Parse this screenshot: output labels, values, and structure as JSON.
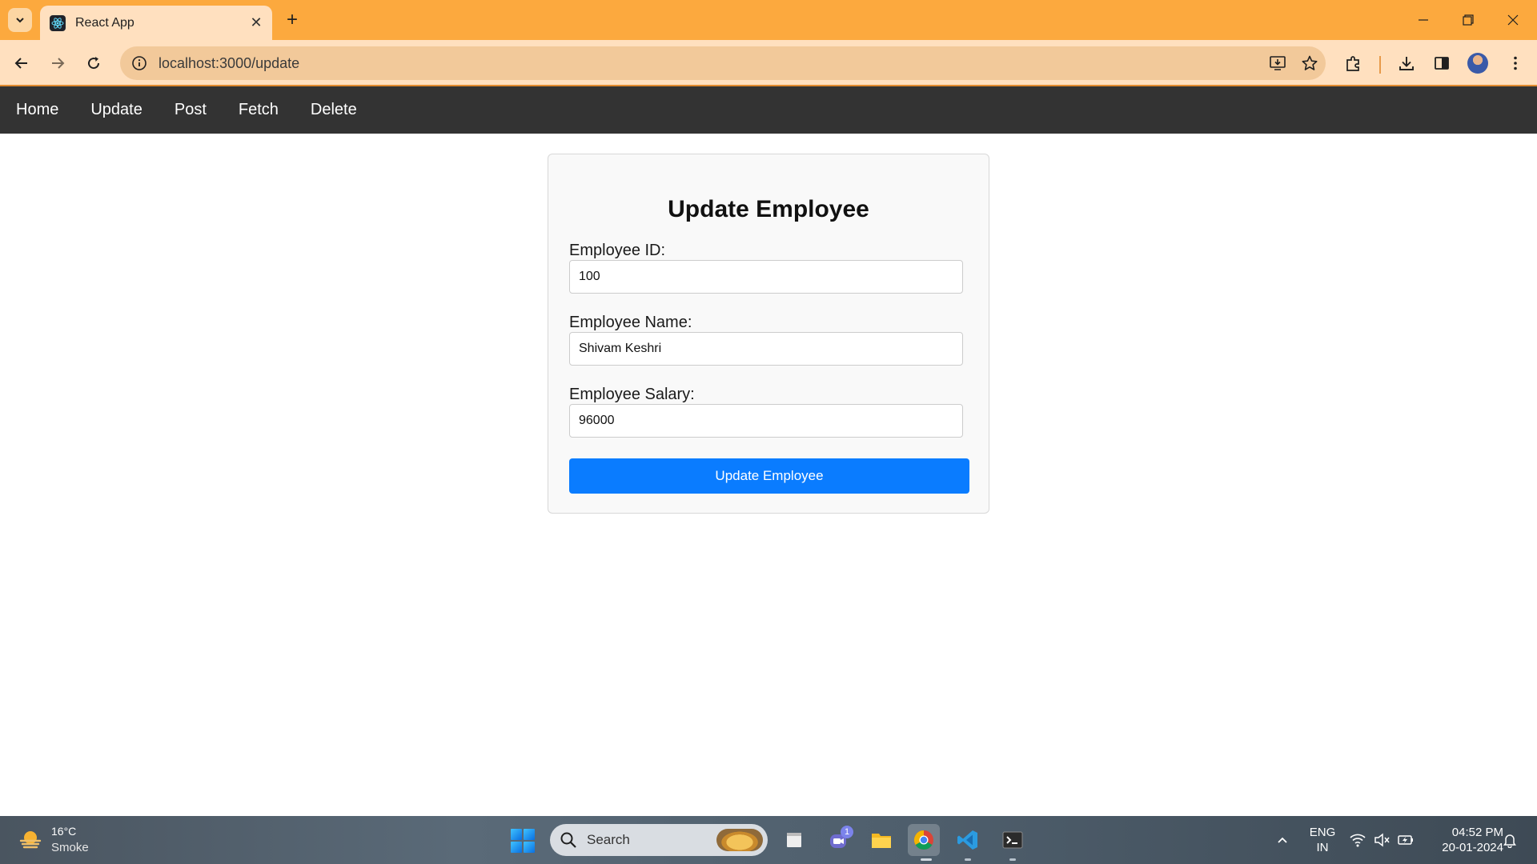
{
  "browser": {
    "tab_title": "React App",
    "url": "localhost:3000/update"
  },
  "appnav": {
    "items": [
      "Home",
      "Update",
      "Post",
      "Fetch",
      "Delete"
    ]
  },
  "form": {
    "title": "Update Employee",
    "id_label": "Employee ID:",
    "id_value": "100",
    "name_label": "Employee Name:",
    "name_value": "Shivam Keshri",
    "salary_label": "Employee Salary:",
    "salary_value": "96000",
    "submit_label": "Update Employee"
  },
  "taskbar": {
    "weather_temp": "16°C",
    "weather_desc": "Smoke",
    "search_placeholder": "Search",
    "teams_badge": "1",
    "lang_line1": "ENG",
    "lang_line2": "IN",
    "time": "04:52 PM",
    "date": "20-01-2024"
  },
  "colors": {
    "chrome_tabbar": "#fca93e",
    "chrome_toolbar": "#ffe0bf",
    "appnav_bg": "#333333",
    "button_primary": "#0a7cff"
  }
}
